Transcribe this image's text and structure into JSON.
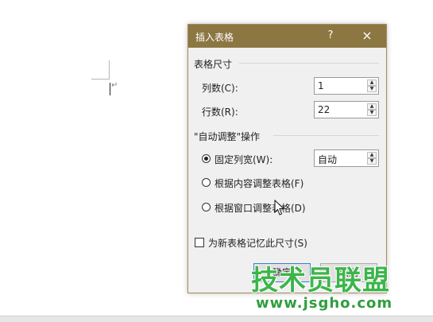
{
  "document": {
    "paragraph_mark": "↵"
  },
  "dialog": {
    "title": "插入表格",
    "help_label": "?",
    "close_label": "×",
    "table_size": {
      "group_label": "表格尺寸",
      "columns_label": "列数(C):",
      "columns_value": "1",
      "rows_label": "行数(R):",
      "rows_value": "22"
    },
    "autofit": {
      "group_label": "\"自动调整\"操作",
      "fixed_width_label": "固定列宽(W):",
      "fixed_width_value": "自动",
      "fit_content_label": "根据内容调整表格(F)",
      "fit_window_label": "根据窗口调整表格(D)",
      "selected_option": "fixed_width"
    },
    "remember_label": "为新表格记忆此尺寸(S)",
    "remember_checked": false,
    "ok_label": "确定",
    "cancel_label": "取消"
  },
  "watermark": {
    "text": "技术员联盟",
    "url": "www.jsgho.com",
    "color": "#3cb54a"
  },
  "colors": {
    "titlebar": "#8c7742",
    "dialog_bg": "#f0f0f0",
    "primary_border": "#3c7fd8"
  }
}
